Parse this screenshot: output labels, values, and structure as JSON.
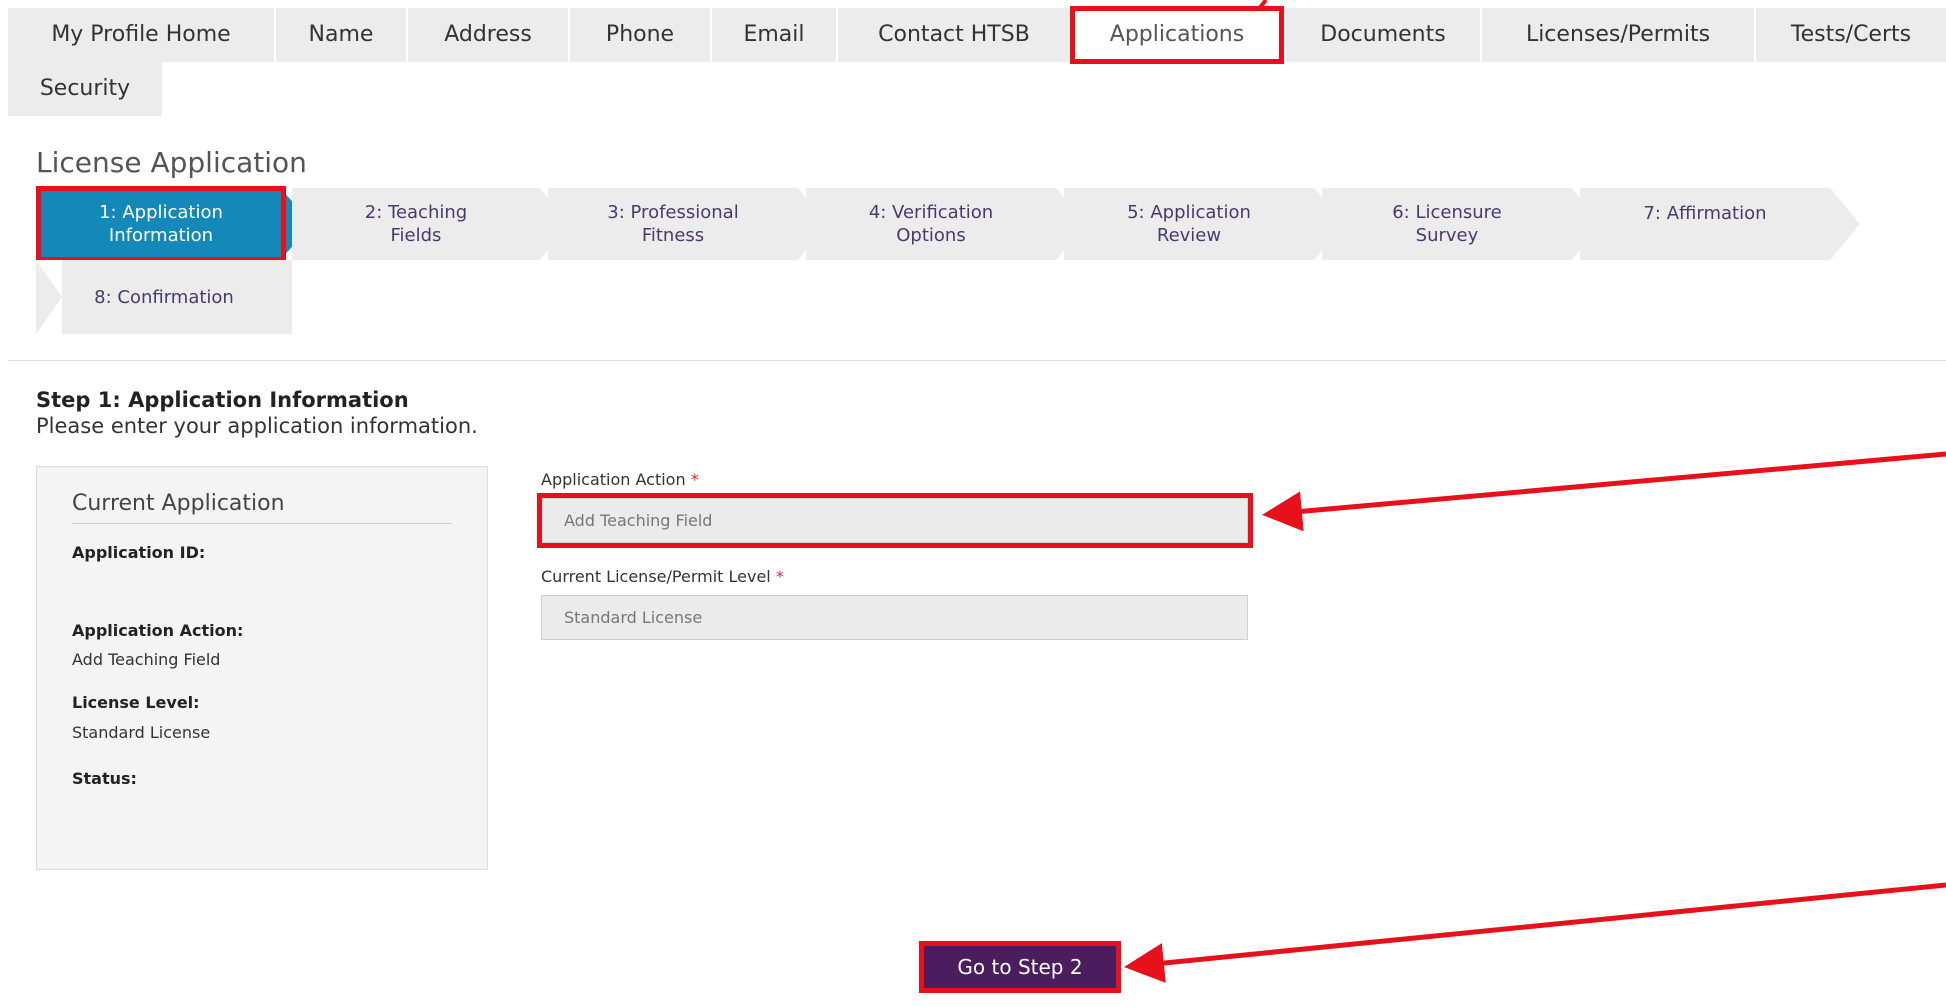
{
  "tabs": [
    {
      "label": "My Profile Home"
    },
    {
      "label": "Name"
    },
    {
      "label": "Address"
    },
    {
      "label": "Phone"
    },
    {
      "label": "Email"
    },
    {
      "label": "Contact HTSB"
    },
    {
      "label": "Applications"
    },
    {
      "label": "Documents"
    },
    {
      "label": "Licenses/Permits"
    },
    {
      "label": "Tests/Certs"
    },
    {
      "label": "Security"
    }
  ],
  "page": {
    "title": "License Application"
  },
  "wizard": {
    "steps": [
      {
        "line1": "1: Application",
        "line2": "Information"
      },
      {
        "line1": "2: Teaching",
        "line2": "Fields"
      },
      {
        "line1": "3: Professional",
        "line2": "Fitness"
      },
      {
        "line1": "4: Verification",
        "line2": "Options"
      },
      {
        "line1": "5: Application",
        "line2": "Review"
      },
      {
        "line1": "6: Licensure",
        "line2": "Survey"
      },
      {
        "line1": "7: Affirmation",
        "line2": ""
      },
      {
        "line1": "8: Confirmation",
        "line2": ""
      }
    ]
  },
  "step": {
    "heading": "Step 1: Application Information",
    "description": "Please enter your application information."
  },
  "current_application": {
    "title": "Current Application",
    "id_label": "Application ID:",
    "id_value": "",
    "action_label": "Application Action:",
    "action_value": "Add Teaching Field",
    "level_label": "License Level:",
    "level_value": "Standard License",
    "status_label": "Status:",
    "status_value": ""
  },
  "form": {
    "action_label": "Application Action",
    "action_value": "Add Teaching Field",
    "level_label": "Current License/Permit Level",
    "level_value": "Standard License",
    "required_mark": "*"
  },
  "buttons": {
    "next": "Go to Step 2"
  },
  "colors": {
    "highlight": "#e8101a",
    "active_step": "#1489b9",
    "button": "#4b1d5f",
    "inactive": "#ececec"
  }
}
